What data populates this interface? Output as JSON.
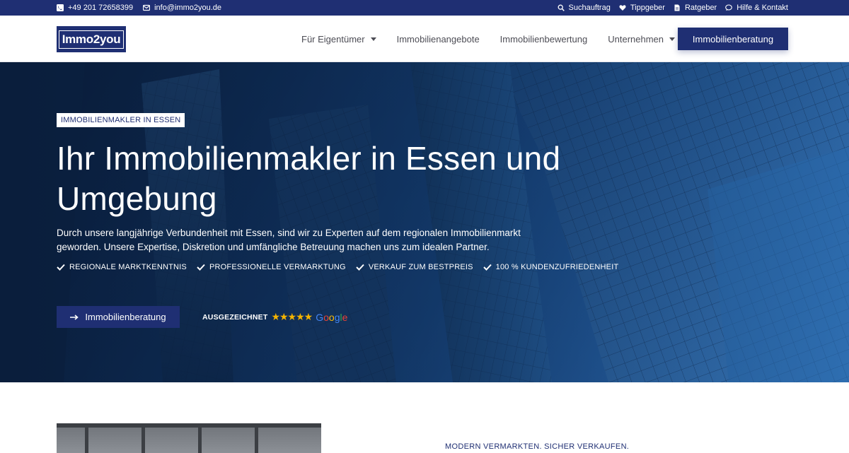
{
  "topbar": {
    "phone": "+49 201 72658399",
    "email": "info@immo2you.de",
    "links": [
      {
        "label": "Suchauftrag",
        "icon": "search-icon"
      },
      {
        "label": "Tippgeber",
        "icon": "heart-icon"
      },
      {
        "label": "Ratgeber",
        "icon": "document-icon"
      },
      {
        "label": "Hilfe & Kontakt",
        "icon": "chat-icon"
      }
    ]
  },
  "header": {
    "logo_text": "Immo2you",
    "nav": [
      {
        "label": "Für Eigentümer",
        "dropdown": true
      },
      {
        "label": "Immobilienangebote",
        "dropdown": false
      },
      {
        "label": "Immobilienbewertung",
        "dropdown": false
      },
      {
        "label": "Unternehmen",
        "dropdown": true
      }
    ],
    "cta_label": "Immobilienberatung"
  },
  "hero": {
    "badge": "IMMOBILIENMAKLER IN ESSEN",
    "title_line1": "Ihr Immobilienmakler in Essen und",
    "title_line2": "Umgebung",
    "text": "Durch unsere langjährige Verbundenheit mit Essen, sind wir zu Experten auf dem regionalen Immobilienmarkt geworden. Unsere Expertise, Diskretion und umfängliche Betreuung machen uns zum idealen Partner.",
    "features": [
      "REGIONALE MARKTKENNTNIS",
      "PROFESSIONELLE VERMARKTUNG",
      "VERKAUF ZUM BESTPREIS",
      "100 % KUNDENZUFRIEDENHEIT"
    ],
    "button_label": "Immobilienberatung",
    "award_label": "AUSGEZEICHNET",
    "rating_stars": 5,
    "award_brand": "Google"
  },
  "section": {
    "kicker": "MODERN VERMARKTEN. SICHER VERKAUFEN."
  },
  "colors": {
    "brand": "#1f2f73",
    "star": "#f5b400"
  }
}
